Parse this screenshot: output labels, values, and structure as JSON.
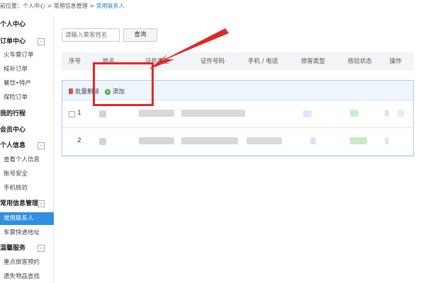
{
  "breadcrumb": {
    "prefix": "前位置：个人中心 > 常用信息管理 > ",
    "current": "常用联系人"
  },
  "sidebar": {
    "groups": [
      {
        "label": "个人中心"
      },
      {
        "label": "订单中心",
        "toggle": "-"
      },
      {
        "label": "我的行程"
      },
      {
        "label": "会员中心"
      },
      {
        "label": "个人信息",
        "toggle": "-"
      },
      {
        "label": "常用信息管理",
        "toggle": "-"
      },
      {
        "label": "温馨服务",
        "toggle": "-"
      }
    ],
    "items": [
      {
        "label": "火车票订单"
      },
      {
        "label": "候补订单"
      },
      {
        "label": "餐饮•特产"
      },
      {
        "label": "保险订单"
      },
      {
        "label": "查看个人信息"
      },
      {
        "label": "账号安全"
      },
      {
        "label": "手机核验"
      },
      {
        "label": "常用联系人",
        "active": true
      },
      {
        "label": "车票快递地址"
      },
      {
        "label": "重点旅客预约"
      },
      {
        "label": "遗失物品查找"
      }
    ]
  },
  "search": {
    "placeholder": "请输入乘客姓名",
    "button": "查询"
  },
  "table": {
    "headers": [
      "序号",
      "姓名",
      "证件类型",
      "证件号码",
      "手机 / 电话",
      "旅客类型",
      "核验状态",
      "操作"
    ],
    "rows": [
      {
        "num": "1"
      },
      {
        "num": "2"
      }
    ]
  },
  "toolbar": {
    "delete_label": "批量删除",
    "add_label": "添加"
  },
  "colors": {
    "accent": "#2f8fe0",
    "highlight": "#e02828",
    "add": "#3bb34a",
    "delete": "#d9534f"
  }
}
